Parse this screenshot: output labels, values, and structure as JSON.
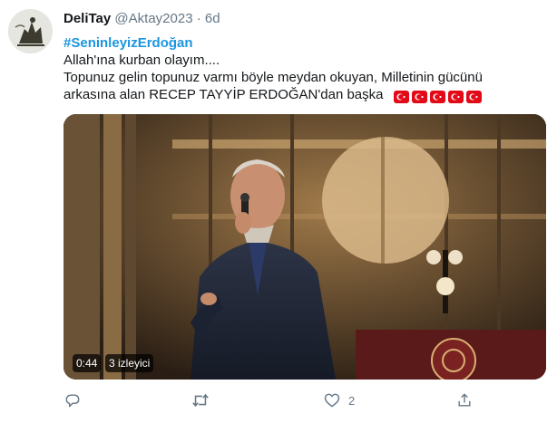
{
  "tweet": {
    "display_name": "DeliTay",
    "handle": "@Aktay2023",
    "separator": "·",
    "time": "6d",
    "hashtag": "#SeninleyizErdoğan",
    "line1": "Allah'ına kurban olayım....",
    "line2": "Topunuz gelin topunuz varmı böyle meydan okuyan, Milletinin gücünü",
    "line3": "arkasına alan RECEP TAYYİP ERDOĞAN'dan başka",
    "flags": [
      "turkey-flag-emoji",
      "turkey-flag-emoji",
      "turkey-flag-emoji",
      "turkey-flag-emoji",
      "turkey-flag-emoji"
    ]
  },
  "video": {
    "duration": "0:44",
    "views": "3 izleyici"
  },
  "actions": {
    "reply_icon": "reply-icon",
    "retweet_icon": "retweet-icon",
    "like_icon": "heart-icon",
    "like_count": "2",
    "share_icon": "share-icon"
  },
  "colors": {
    "hashtag": "#1b95e0",
    "muted": "#657786",
    "flag_red": "#e30a17"
  }
}
